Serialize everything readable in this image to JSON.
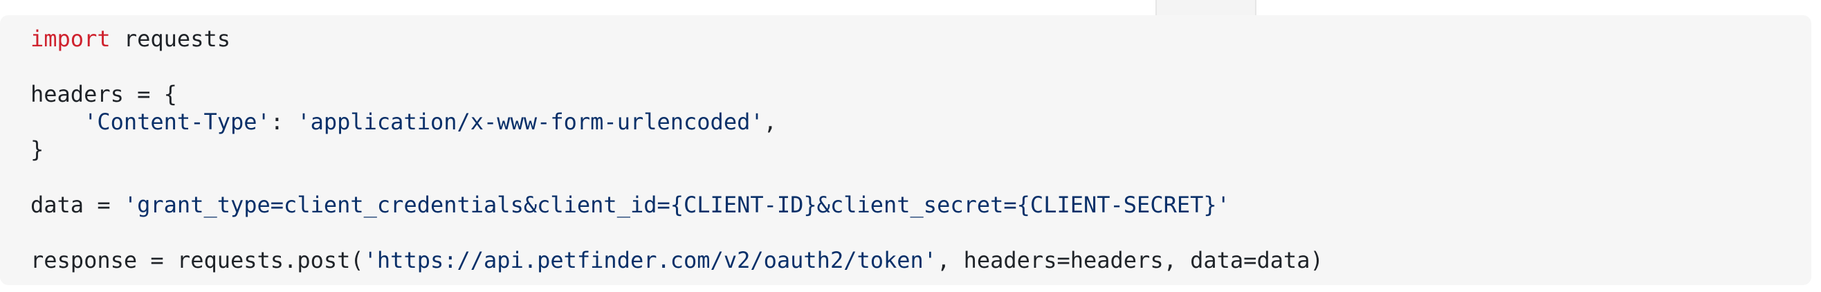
{
  "code": {
    "language": "python",
    "lines": [
      {
        "kw": "import",
        "rest": " requests"
      },
      {
        "text": ""
      },
      {
        "text": "headers = {"
      },
      {
        "indent": "    ",
        "str": "'Content-Type'",
        "mid": ": ",
        "str2": "'application/x-www-form-urlencoded'",
        "tail": ","
      },
      {
        "text": "}"
      },
      {
        "text": ""
      },
      {
        "pre": "data = ",
        "str": "'grant_type=client_credentials&client_id={CLIENT-ID}&client_secret={CLIENT-SECRET}'"
      },
      {
        "text": ""
      },
      {
        "pre": "response = requests.post(",
        "str": "'https://api.petfinder.com/v2/oauth2/token'",
        "tail": ", headers=headers, data=data)"
      }
    ]
  },
  "colors": {
    "keyword": "#cf222e",
    "string": "#0a3069",
    "plain": "#1f2328",
    "background": "#f6f6f6"
  }
}
